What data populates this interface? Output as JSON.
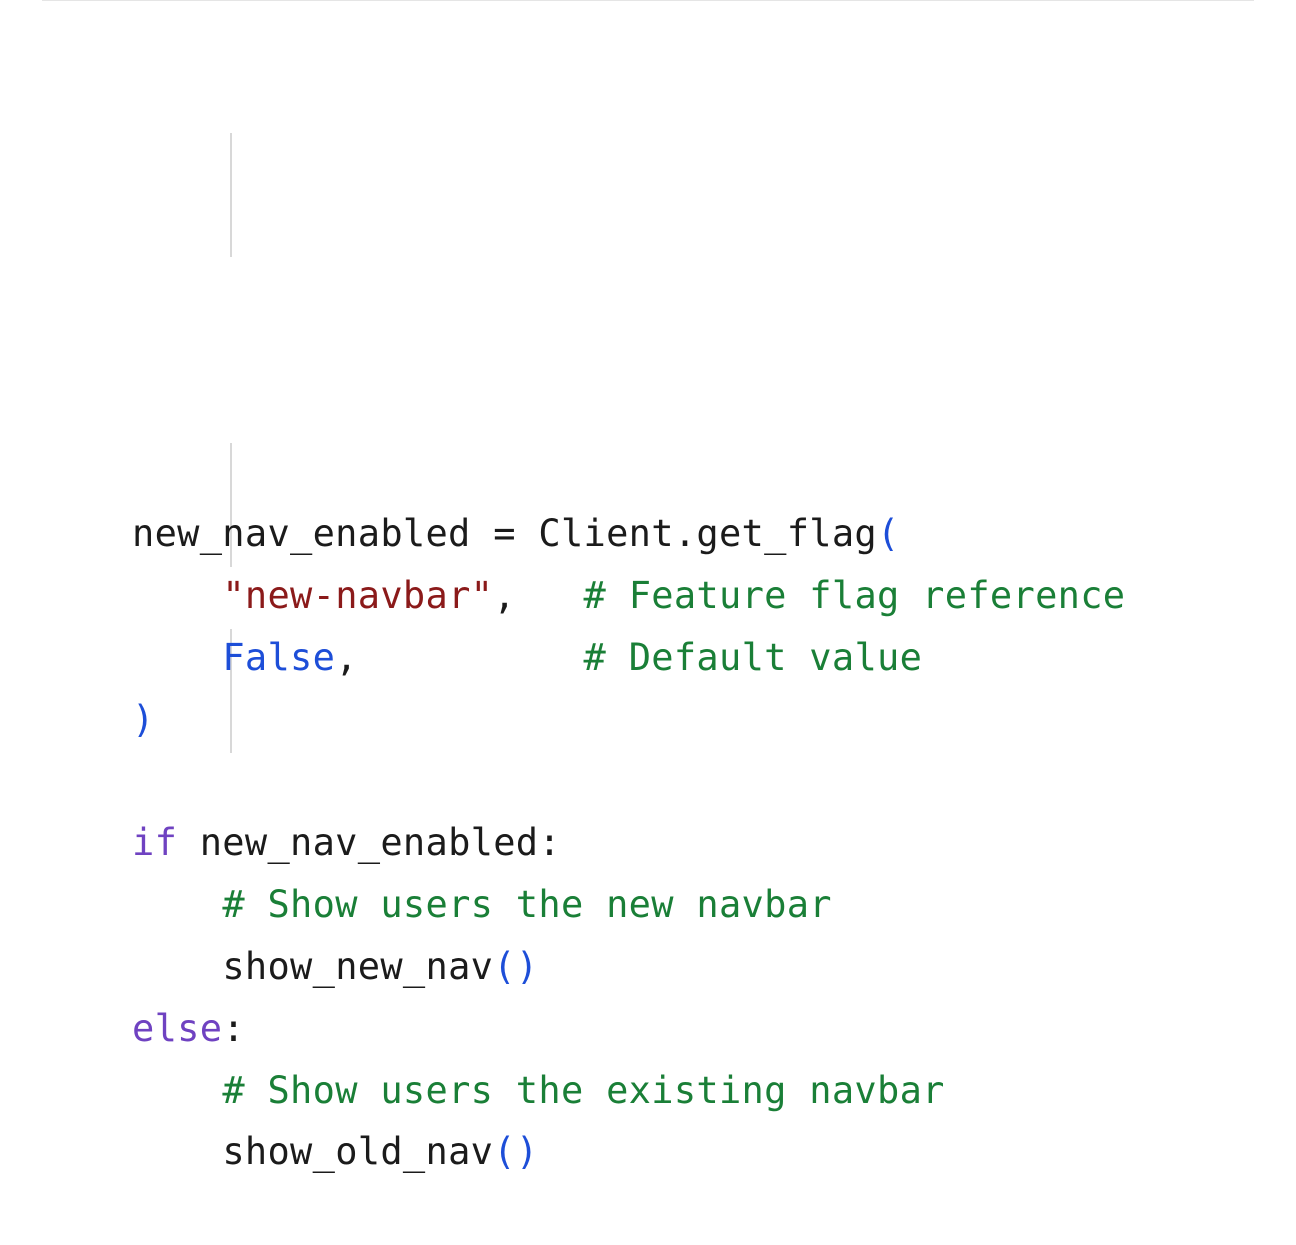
{
  "colors": {
    "default": "#1b1b1b",
    "paren": "#1d4ed8",
    "string": "#8b1a1a",
    "keyword": "#6f42c1",
    "constant": "#1d4ed8",
    "comment": "#1a7f37",
    "guide": "#d8d8d8",
    "rule": "#e5e5e5"
  },
  "code": {
    "l1": {
      "a": "new_nav_enabled ",
      "b": "=",
      "c": " Client",
      "d": ".",
      "e": "get_flag",
      "f": "("
    },
    "l2": {
      "str": "\"new-navbar\"",
      "comma": ",",
      "gap": "   ",
      "cmt": "# Feature flag reference"
    },
    "l3": {
      "const": "False",
      "comma": ",",
      "gap": "          ",
      "cmt": "# Default value"
    },
    "l4": {
      "paren": ")"
    },
    "l6": {
      "kw": "if",
      "a": " new_nav_enabled",
      "colon": ":"
    },
    "l7": {
      "cmt": "# Show users the new navbar"
    },
    "l8": {
      "fn": "show_new_nav",
      "open": "(",
      "close": ")"
    },
    "l9": {
      "kw": "else",
      "colon": ":"
    },
    "l10": {
      "cmt": "# Show users the existing navbar"
    },
    "l11": {
      "fn": "show_old_nav",
      "open": "(",
      "close": ")"
    }
  }
}
